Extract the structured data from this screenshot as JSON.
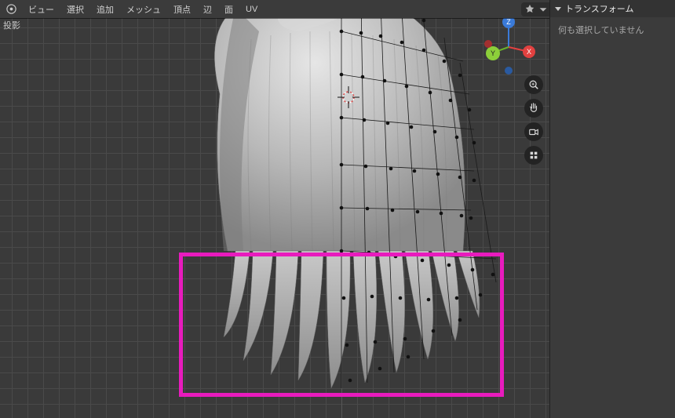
{
  "header": {
    "menus": [
      "ビュー",
      "選択",
      "追加",
      "メッシュ",
      "頂点",
      "辺",
      "面",
      "UV"
    ]
  },
  "viewport": {
    "label": "投影"
  },
  "panel": {
    "title": "トランスフォーム",
    "empty_text": "何も選択していません"
  },
  "gizmo": {
    "x": "X",
    "y": "Y",
    "z": "Z"
  },
  "colors": {
    "axis_x": "#e24140",
    "axis_y": "#6ab22a",
    "axis_z": "#3a7ad8",
    "highlight": "#e81bbd"
  }
}
